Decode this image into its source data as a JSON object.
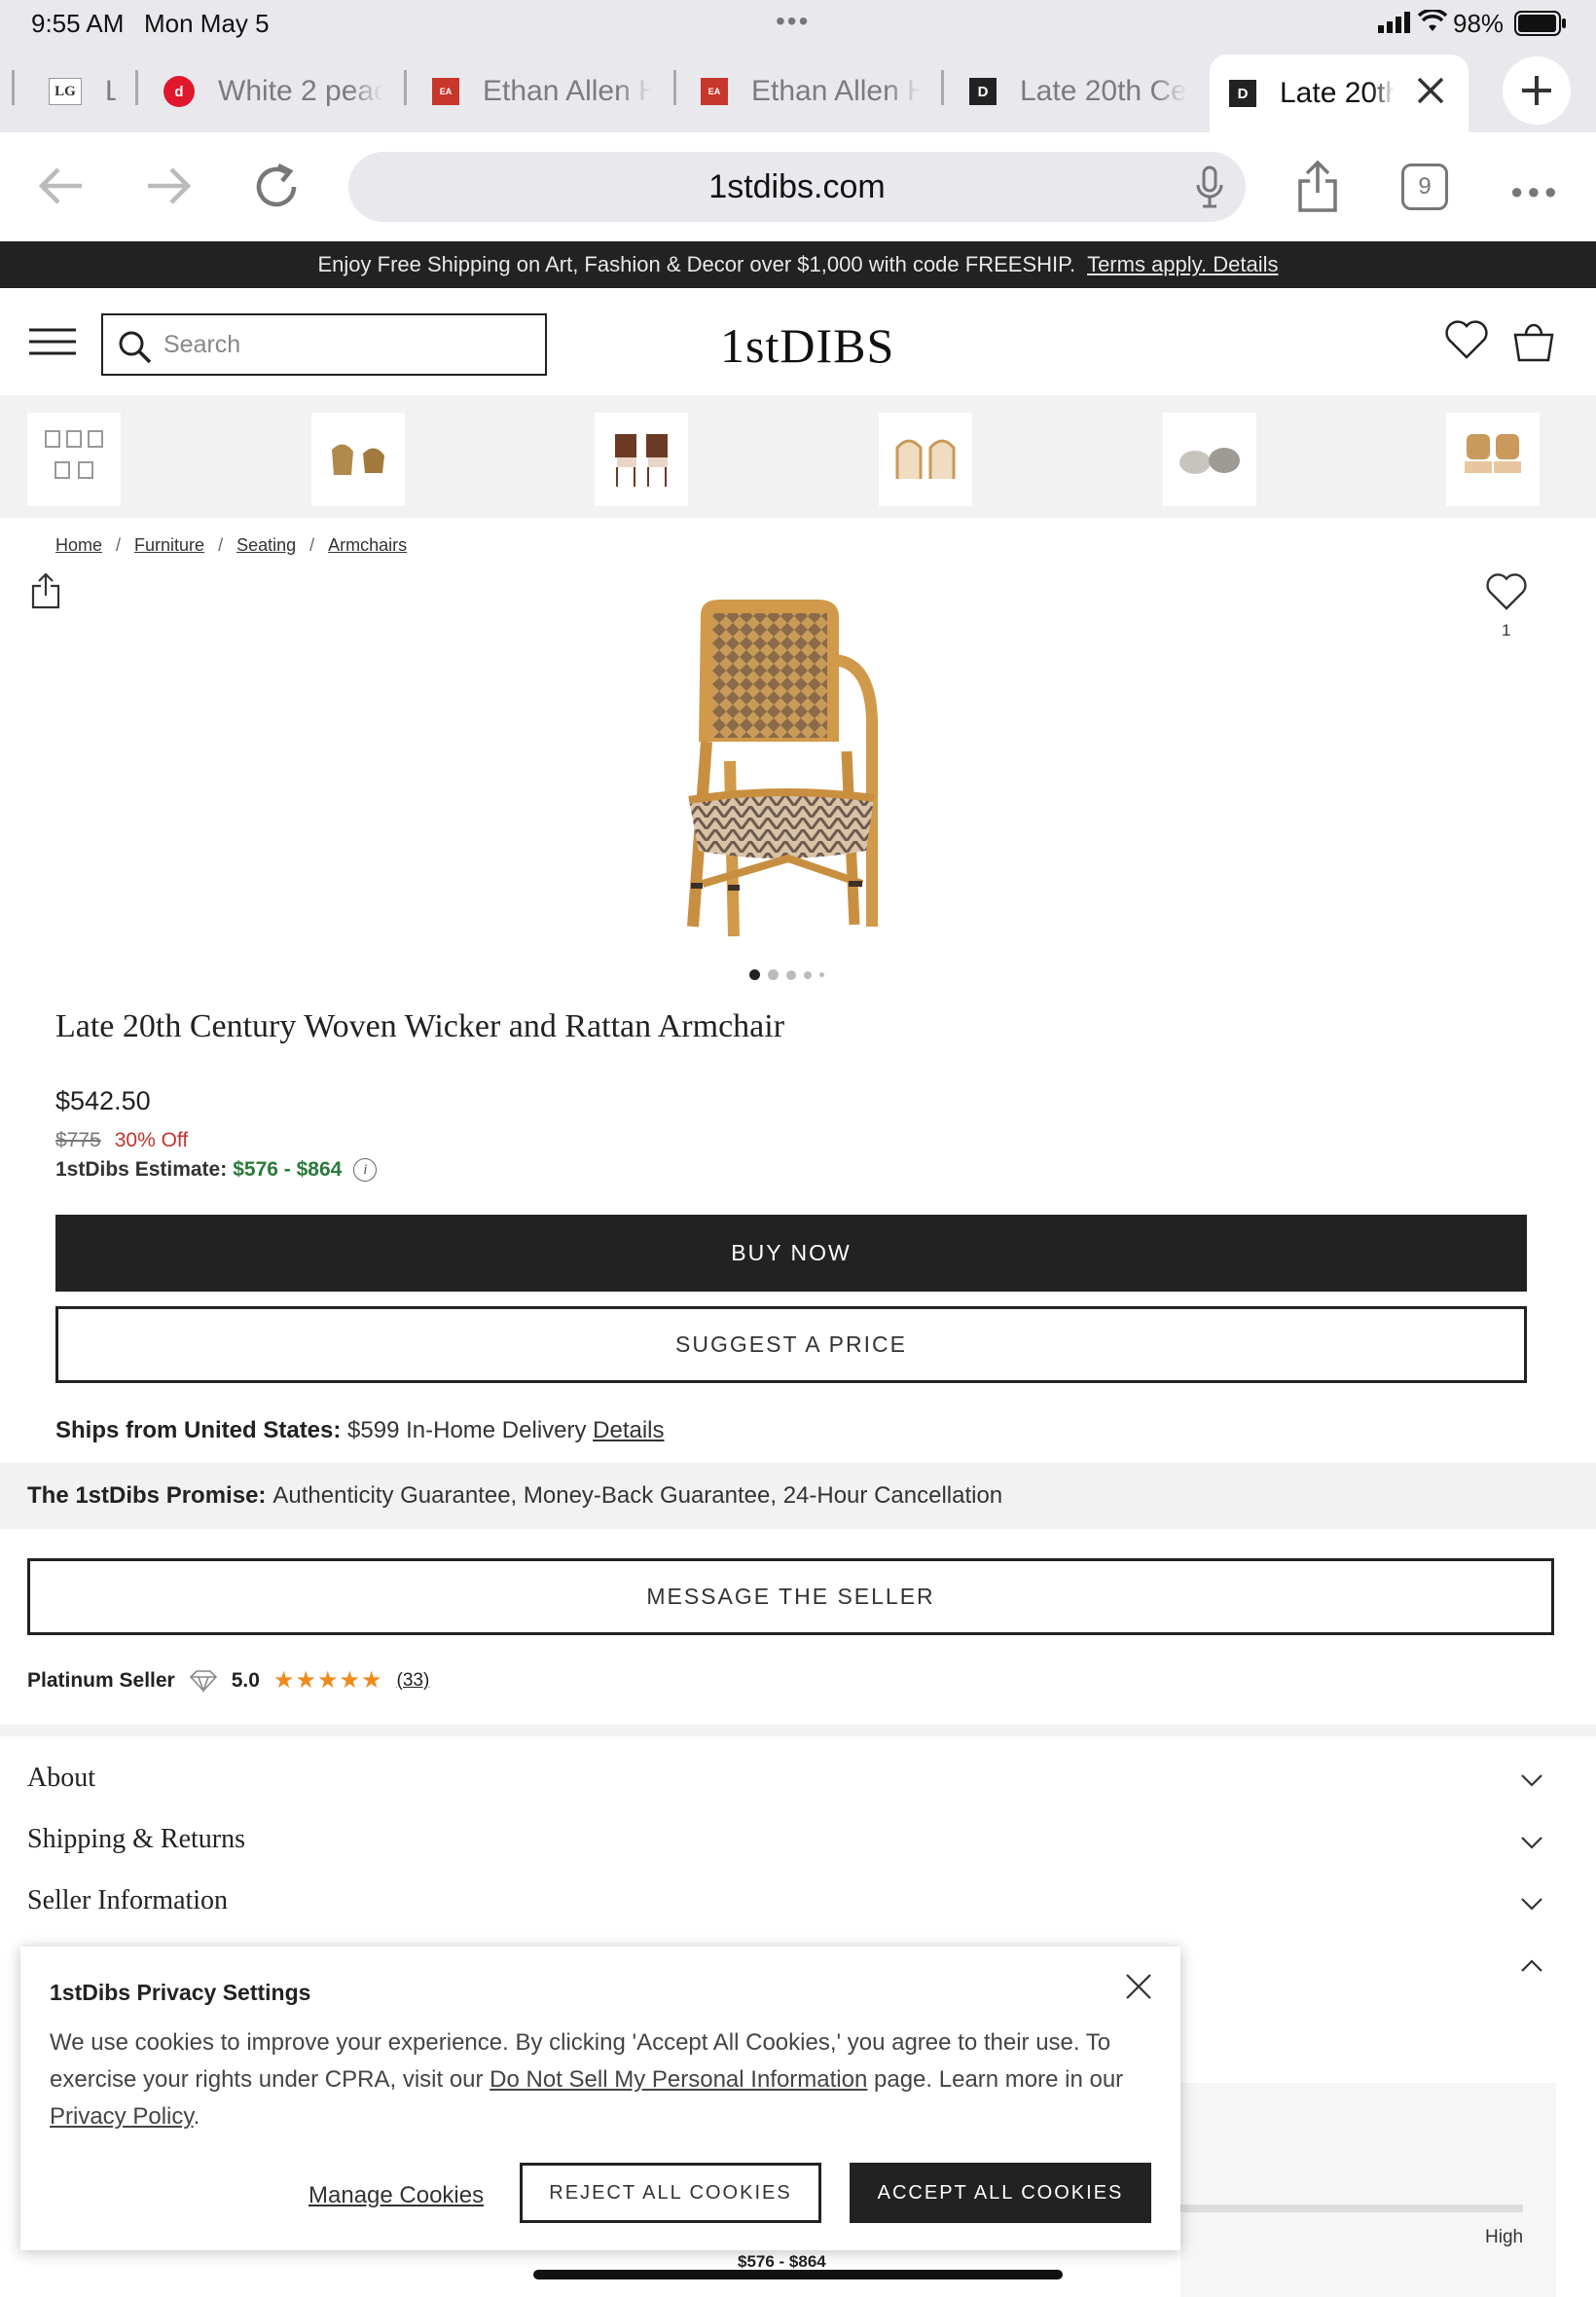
{
  "status": {
    "time": "9:55 AM",
    "date": "Mon May 5",
    "battery": "98%"
  },
  "tabs": [
    {
      "label": "L",
      "icon": "LG",
      "active": false
    },
    {
      "label": "White 2 peac",
      "icon": "d",
      "active": false
    },
    {
      "label": "Ethan Allen H",
      "icon": "ethan-allen",
      "active": false
    },
    {
      "label": "Ethan Allen H",
      "icon": "ethan-allen",
      "active": false
    },
    {
      "label": "Late 20th Ce",
      "icon": "D",
      "active": false
    },
    {
      "label": "Late 20th",
      "icon": "D",
      "active": true
    }
  ],
  "toolbar": {
    "url": "1stdibs.com",
    "tab_count": "9"
  },
  "promo": {
    "text": "Enjoy Free Shipping on Art, Fashion & Decor over $1,000 with code FREESHIP.",
    "link": "Terms apply. Details"
  },
  "header": {
    "search_placeholder": "Search",
    "logo": "1stDIBS"
  },
  "breadcrumb": [
    "Home",
    "Furniture",
    "Seating",
    "Armchairs"
  ],
  "product": {
    "favorites_count": "1",
    "title": "Late 20th Century Woven Wicker and Rattan Armchair",
    "price": "$542.50",
    "original_price": "$775",
    "discount": "30% Off",
    "estimate_label": "1stDibs Estimate:",
    "estimate_range": "$576 - $864",
    "buy_label": "BUY NOW",
    "suggest_label": "SUGGEST A PRICE",
    "ships_label": "Ships from United States:",
    "ships_text": "$599 In-Home Delivery",
    "ships_link": "Details",
    "carousel_count": 5,
    "carousel_active": 0
  },
  "promise": {
    "label": "The 1stDibs Promise:",
    "text": "Authenticity Guarantee, Money-Back Guarantee, 24-Hour Cancellation"
  },
  "seller": {
    "message_label": "MESSAGE THE SELLER",
    "tier": "Platinum Seller",
    "rating": "5.0",
    "reviews": "(33)"
  },
  "accordion": [
    "About",
    "Shipping & Returns",
    "Seller Information"
  ],
  "privacy": {
    "title": "1stDibs Privacy Settings",
    "body_1": "We use cookies to improve your experience. By clicking 'Accept All Cookies,' you agree to their use. To exercise your rights under CPRA, visit our",
    "link_1": "Do Not Sell My Personal Information",
    "body_2": "page. Learn more in our",
    "link_2": "Privacy Policy",
    "body_3": ".",
    "manage": "Manage Cookies",
    "reject": "REJECT ALL COOKIES",
    "accept": "ACCEPT ALL COOKIES"
  },
  "estimate_panel": {
    "high_label": "High",
    "range": "$576 - $864"
  },
  "colors": {
    "dark": "#222222",
    "green": "#2a7a3a",
    "red": "#c2332f",
    "star": "#f08a1c"
  }
}
